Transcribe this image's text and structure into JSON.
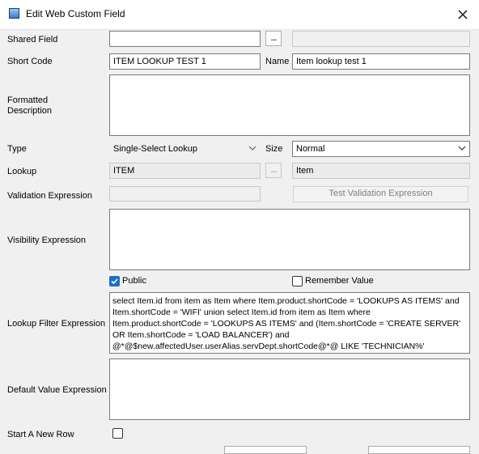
{
  "window": {
    "title": "Edit Web Custom Field",
    "icon": "dialog-app-icon",
    "close_icon": "close-icon"
  },
  "labels": {
    "shared_field": "Shared Field",
    "short_code": "Short Code",
    "name": "Name",
    "formatted_description": "Formatted\nDescription",
    "type": "Type",
    "size": "Size",
    "lookup": "Lookup",
    "validation_expression": "Validation Expression",
    "visibility_expression": "Visibility Expression",
    "lookup_filter_expression": "Lookup Filter Expression",
    "default_value_expression": "Default Value Expression",
    "start_new_row": "Start A New Row"
  },
  "fields": {
    "shared_field_value": "",
    "shared_field_display": "",
    "short_code_value": "ITEM LOOKUP TEST 1",
    "name_value": "Item lookup test 1",
    "formatted_description_value": "",
    "type_value": "Single-Select Lookup",
    "size_value": "Normal",
    "lookup_value": "ITEM",
    "lookup_display": "Item",
    "validation_expression_value": "",
    "visibility_expression_value": "",
    "lookup_filter_expression_value": "select Item.id from item as Item where Item.product.shortCode = 'LOOKUPS AS ITEMS' and\nItem.shortCode = 'WIFI' union select Item.id from item as Item where\nItem.product.shortCode = 'LOOKUPS AS ITEMS' and (Item.shortCode = 'CREATE SERVER'\nOR Item.shortCode = 'LOAD BALANCER') and\n@*@$new.affectedUser.userAlias.servDept.shortCode@*@ LIKE 'TECHNICIAN%'",
    "default_value_expression_value": ""
  },
  "buttons": {
    "browse_label": "...",
    "test_validation_label": "Test Validation Expression"
  },
  "checkboxes": {
    "public": {
      "label": "Public",
      "checked": true
    },
    "remember_value": {
      "label": "Remember Value",
      "checked": false
    },
    "start_new_row": {
      "checked": false
    }
  },
  "colors": {
    "accent": "#1b6fc9",
    "dialog_bg": "#f0f0f0",
    "disabled_text": "#7f7f7f"
  }
}
